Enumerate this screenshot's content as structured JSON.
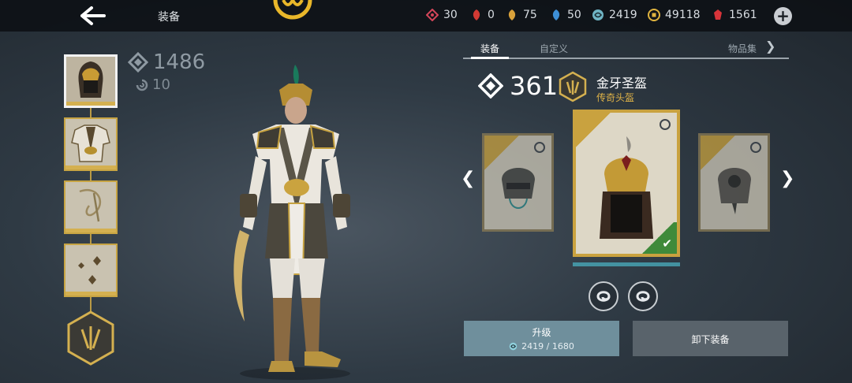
{
  "header": {
    "title": "装备",
    "resources": [
      {
        "name": "red-gem",
        "icon": "red-diamond-icon",
        "value": "30",
        "color": "#d4465a"
      },
      {
        "name": "red-leaf",
        "icon": "red-leaf-icon",
        "value": "0",
        "color": "#d23a34"
      },
      {
        "name": "gold-leaf",
        "icon": "gold-leaf-icon",
        "value": "75",
        "color": "#d9a13a"
      },
      {
        "name": "blue-leaf",
        "icon": "blue-leaf-icon",
        "value": "50",
        "color": "#3d8fd6"
      },
      {
        "name": "essence",
        "icon": "swirl-icon",
        "value": "2419",
        "color": "#6fb4c4"
      },
      {
        "name": "coins",
        "icon": "coin-icon",
        "value": "49118",
        "color": "#e0b43f"
      },
      {
        "name": "rubies",
        "icon": "ruby-icon",
        "value": "1561",
        "color": "#d8343a"
      }
    ],
    "plus_label": "+"
  },
  "character_stats": {
    "power": "1486",
    "rank": "10"
  },
  "tabs": [
    {
      "label": "装备",
      "active": true
    },
    {
      "label": "自定义",
      "active": false
    },
    {
      "label": "物品集",
      "active": false
    }
  ],
  "item": {
    "power": "361",
    "name": "金牙圣盔",
    "rarity": "传奇头盔",
    "rarity_color": "#e0b347"
  },
  "actions": {
    "upgrade_label": "升级",
    "upgrade_cost": "2419 / 1680",
    "unequip_label": "卸下装备"
  },
  "colors": {
    "gold": "#c9a23f",
    "equipped": "#3f8a3a",
    "upgrade_bg": "#6f8f9c"
  }
}
